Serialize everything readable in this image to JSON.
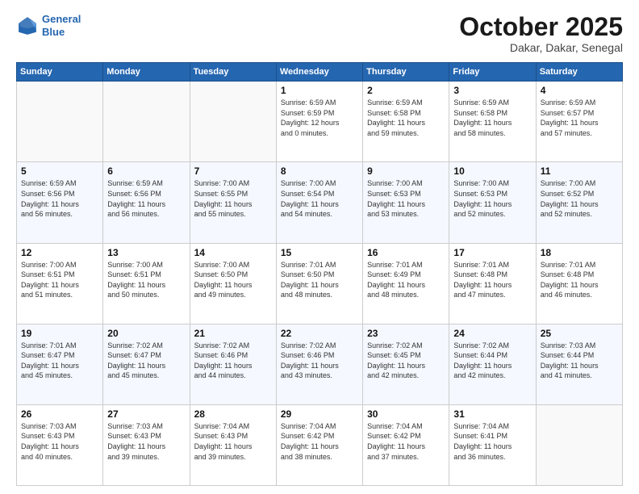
{
  "header": {
    "logo_line1": "General",
    "logo_line2": "Blue",
    "month_title": "October 2025",
    "location": "Dakar, Dakar, Senegal"
  },
  "weekdays": [
    "Sunday",
    "Monday",
    "Tuesday",
    "Wednesday",
    "Thursday",
    "Friday",
    "Saturday"
  ],
  "weeks": [
    [
      {
        "day": "",
        "info": ""
      },
      {
        "day": "",
        "info": ""
      },
      {
        "day": "",
        "info": ""
      },
      {
        "day": "1",
        "info": "Sunrise: 6:59 AM\nSunset: 6:59 PM\nDaylight: 12 hours\nand 0 minutes."
      },
      {
        "day": "2",
        "info": "Sunrise: 6:59 AM\nSunset: 6:58 PM\nDaylight: 11 hours\nand 59 minutes."
      },
      {
        "day": "3",
        "info": "Sunrise: 6:59 AM\nSunset: 6:58 PM\nDaylight: 11 hours\nand 58 minutes."
      },
      {
        "day": "4",
        "info": "Sunrise: 6:59 AM\nSunset: 6:57 PM\nDaylight: 11 hours\nand 57 minutes."
      }
    ],
    [
      {
        "day": "5",
        "info": "Sunrise: 6:59 AM\nSunset: 6:56 PM\nDaylight: 11 hours\nand 56 minutes."
      },
      {
        "day": "6",
        "info": "Sunrise: 6:59 AM\nSunset: 6:56 PM\nDaylight: 11 hours\nand 56 minutes."
      },
      {
        "day": "7",
        "info": "Sunrise: 7:00 AM\nSunset: 6:55 PM\nDaylight: 11 hours\nand 55 minutes."
      },
      {
        "day": "8",
        "info": "Sunrise: 7:00 AM\nSunset: 6:54 PM\nDaylight: 11 hours\nand 54 minutes."
      },
      {
        "day": "9",
        "info": "Sunrise: 7:00 AM\nSunset: 6:53 PM\nDaylight: 11 hours\nand 53 minutes."
      },
      {
        "day": "10",
        "info": "Sunrise: 7:00 AM\nSunset: 6:53 PM\nDaylight: 11 hours\nand 52 minutes."
      },
      {
        "day": "11",
        "info": "Sunrise: 7:00 AM\nSunset: 6:52 PM\nDaylight: 11 hours\nand 52 minutes."
      }
    ],
    [
      {
        "day": "12",
        "info": "Sunrise: 7:00 AM\nSunset: 6:51 PM\nDaylight: 11 hours\nand 51 minutes."
      },
      {
        "day": "13",
        "info": "Sunrise: 7:00 AM\nSunset: 6:51 PM\nDaylight: 11 hours\nand 50 minutes."
      },
      {
        "day": "14",
        "info": "Sunrise: 7:00 AM\nSunset: 6:50 PM\nDaylight: 11 hours\nand 49 minutes."
      },
      {
        "day": "15",
        "info": "Sunrise: 7:01 AM\nSunset: 6:50 PM\nDaylight: 11 hours\nand 48 minutes."
      },
      {
        "day": "16",
        "info": "Sunrise: 7:01 AM\nSunset: 6:49 PM\nDaylight: 11 hours\nand 48 minutes."
      },
      {
        "day": "17",
        "info": "Sunrise: 7:01 AM\nSunset: 6:48 PM\nDaylight: 11 hours\nand 47 minutes."
      },
      {
        "day": "18",
        "info": "Sunrise: 7:01 AM\nSunset: 6:48 PM\nDaylight: 11 hours\nand 46 minutes."
      }
    ],
    [
      {
        "day": "19",
        "info": "Sunrise: 7:01 AM\nSunset: 6:47 PM\nDaylight: 11 hours\nand 45 minutes."
      },
      {
        "day": "20",
        "info": "Sunrise: 7:02 AM\nSunset: 6:47 PM\nDaylight: 11 hours\nand 45 minutes."
      },
      {
        "day": "21",
        "info": "Sunrise: 7:02 AM\nSunset: 6:46 PM\nDaylight: 11 hours\nand 44 minutes."
      },
      {
        "day": "22",
        "info": "Sunrise: 7:02 AM\nSunset: 6:46 PM\nDaylight: 11 hours\nand 43 minutes."
      },
      {
        "day": "23",
        "info": "Sunrise: 7:02 AM\nSunset: 6:45 PM\nDaylight: 11 hours\nand 42 minutes."
      },
      {
        "day": "24",
        "info": "Sunrise: 7:02 AM\nSunset: 6:44 PM\nDaylight: 11 hours\nand 42 minutes."
      },
      {
        "day": "25",
        "info": "Sunrise: 7:03 AM\nSunset: 6:44 PM\nDaylight: 11 hours\nand 41 minutes."
      }
    ],
    [
      {
        "day": "26",
        "info": "Sunrise: 7:03 AM\nSunset: 6:43 PM\nDaylight: 11 hours\nand 40 minutes."
      },
      {
        "day": "27",
        "info": "Sunrise: 7:03 AM\nSunset: 6:43 PM\nDaylight: 11 hours\nand 39 minutes."
      },
      {
        "day": "28",
        "info": "Sunrise: 7:04 AM\nSunset: 6:43 PM\nDaylight: 11 hours\nand 39 minutes."
      },
      {
        "day": "29",
        "info": "Sunrise: 7:04 AM\nSunset: 6:42 PM\nDaylight: 11 hours\nand 38 minutes."
      },
      {
        "day": "30",
        "info": "Sunrise: 7:04 AM\nSunset: 6:42 PM\nDaylight: 11 hours\nand 37 minutes."
      },
      {
        "day": "31",
        "info": "Sunrise: 7:04 AM\nSunset: 6:41 PM\nDaylight: 11 hours\nand 36 minutes."
      },
      {
        "day": "",
        "info": ""
      }
    ]
  ]
}
